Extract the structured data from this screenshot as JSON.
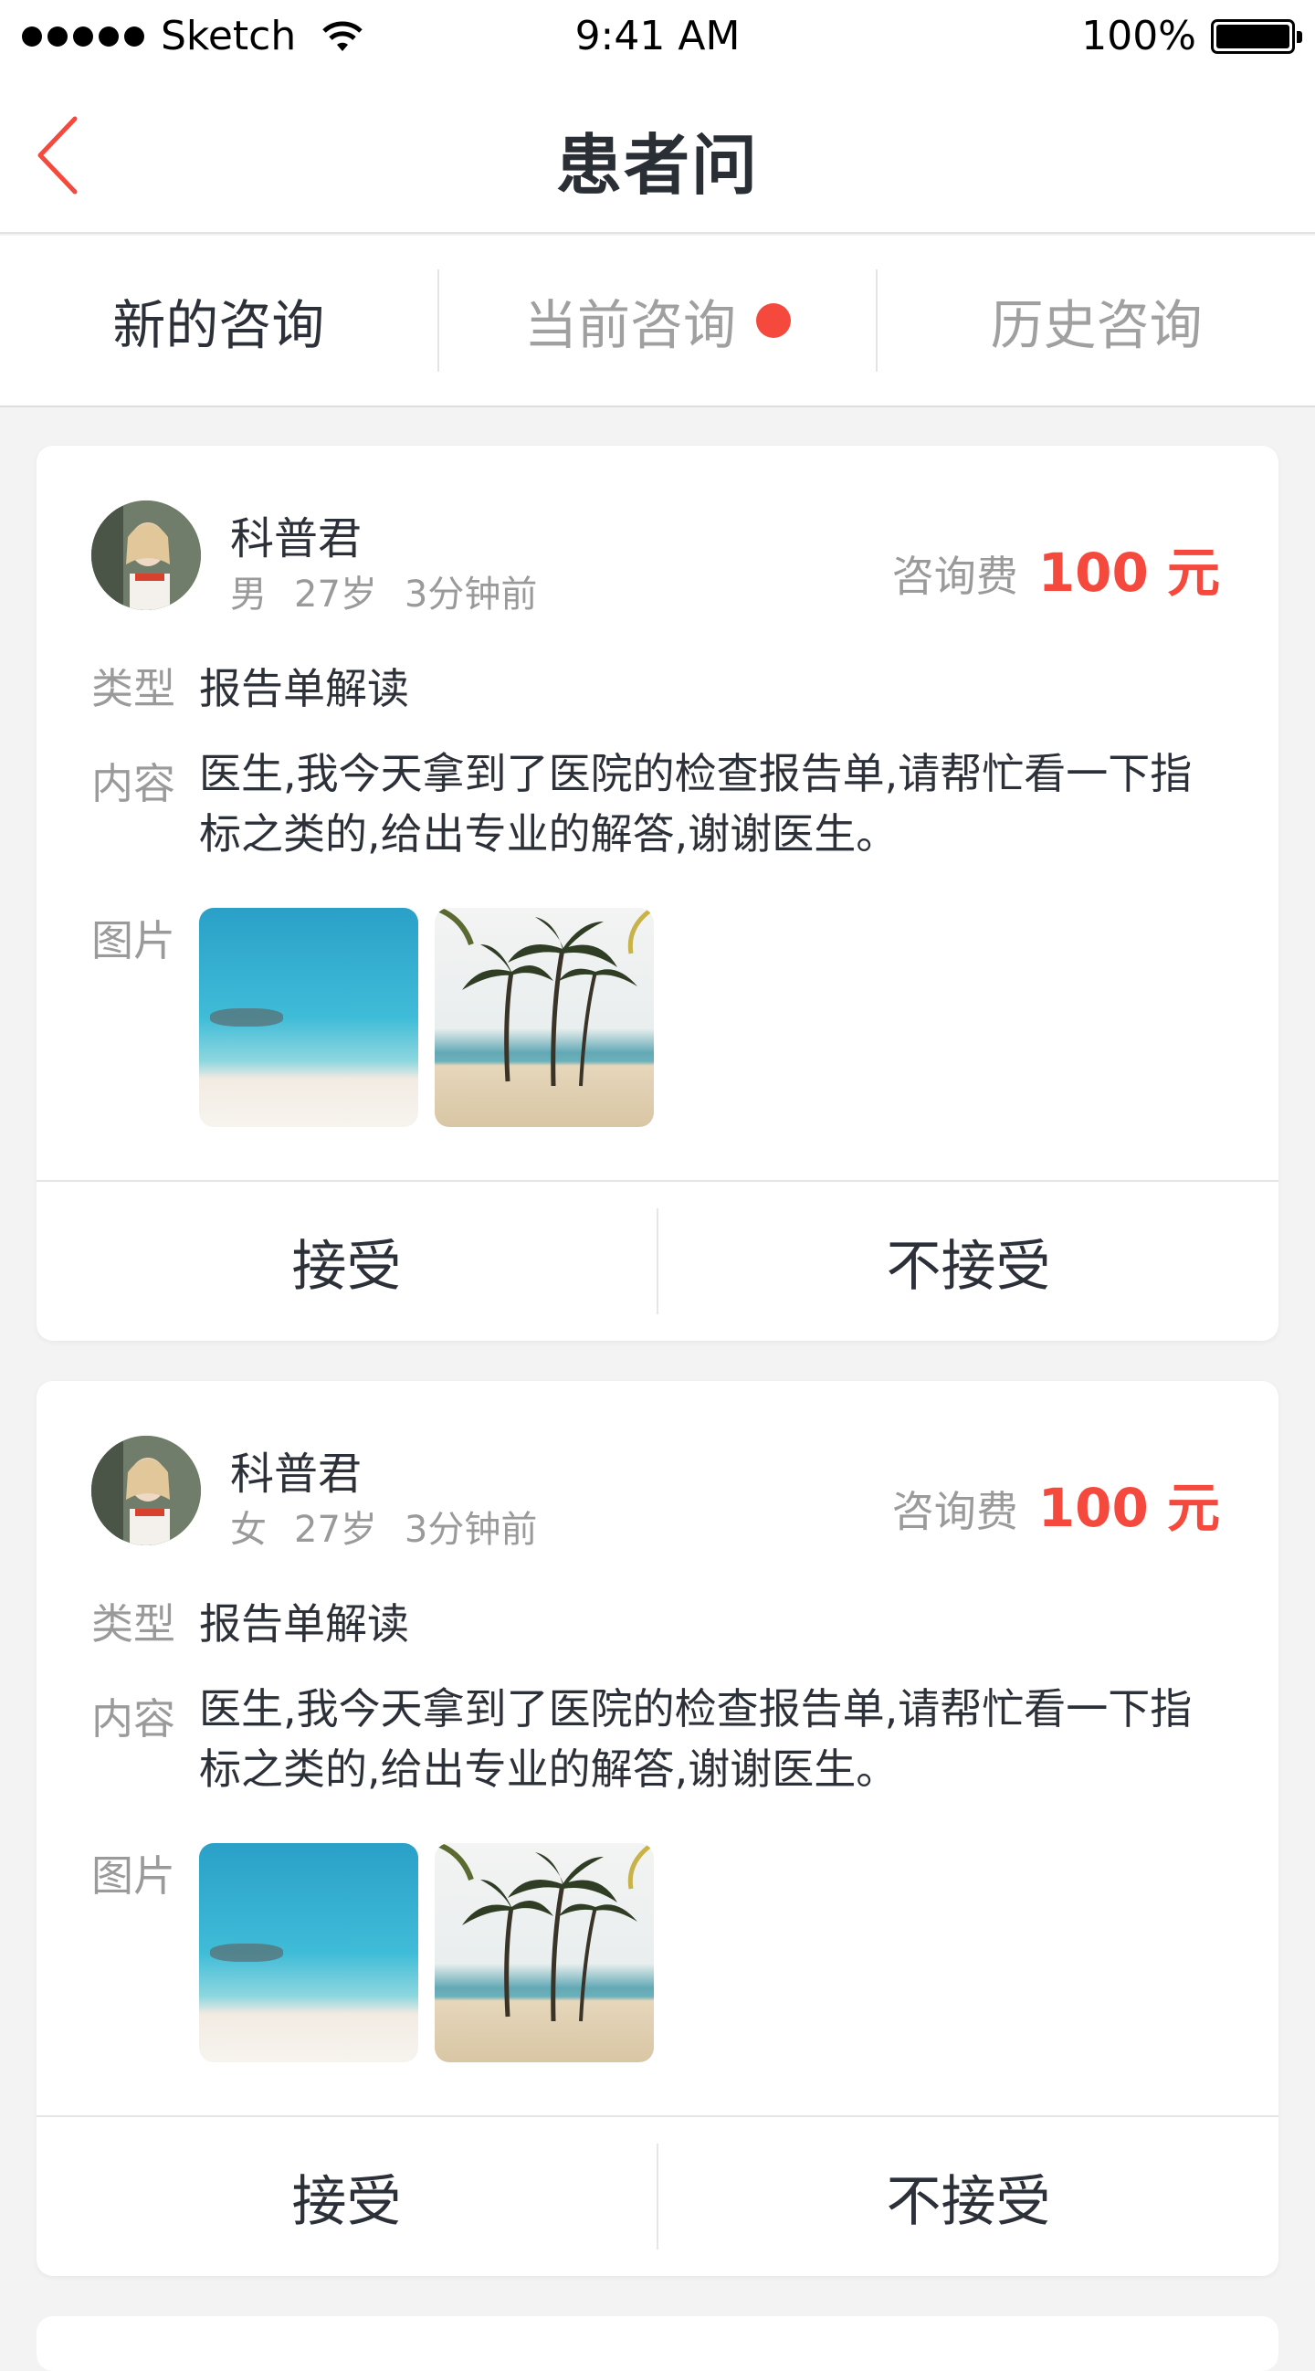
{
  "status_bar": {
    "carrier": "Sketch",
    "time": "9:41 AM",
    "battery": "100%"
  },
  "nav": {
    "title": "患者问"
  },
  "tabs": [
    {
      "label": "新的咨询",
      "active": true
    },
    {
      "label": "当前咨询",
      "active": false,
      "badge": true
    },
    {
      "label": "历史咨询",
      "active": false
    }
  ],
  "colors": {
    "accent": "#f4493c",
    "text_primary": "#2c3038",
    "text_secondary": "#9a9a9a"
  },
  "consultations": [
    {
      "name": "科普君",
      "gender": "男",
      "age": "27岁",
      "time_ago": "3分钟前",
      "fee_label": "咨询费",
      "fee_value": "100 元",
      "type_label": "类型",
      "type_value": "报告单解读",
      "content_label": "内容",
      "content_value": "医生,我今天拿到了医院的检查报告单,请帮忙看一下指标之类的,给出专业的解答,谢谢医生。",
      "images_label": "图片",
      "images": [
        "sea",
        "palm"
      ],
      "accept_label": "接受",
      "reject_label": "不接受"
    },
    {
      "name": "科普君",
      "gender": "女",
      "age": "27岁",
      "time_ago": "3分钟前",
      "fee_label": "咨询费",
      "fee_value": "100 元",
      "type_label": "类型",
      "type_value": "报告单解读",
      "content_label": "内容",
      "content_value": "医生,我今天拿到了医院的检查报告单,请帮忙看一下指标之类的,给出专业的解答,谢谢医生。",
      "images_label": "图片",
      "images": [
        "sea",
        "palm"
      ],
      "accept_label": "接受",
      "reject_label": "不接受"
    }
  ]
}
